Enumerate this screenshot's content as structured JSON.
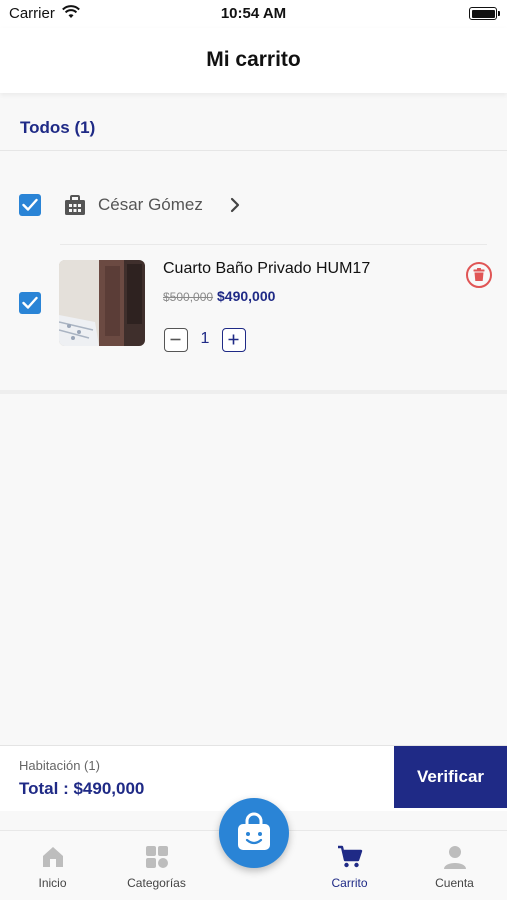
{
  "status_bar": {
    "carrier": "Carrier",
    "time": "10:54 AM"
  },
  "nav": {
    "title": "Mi carrito"
  },
  "cart": {
    "select_all_label": "Todos (1)",
    "seller": {
      "name": "César Gómez",
      "checked": true
    },
    "item": {
      "title": "Cuarto Baño Privado HUM17",
      "old_price": "$500,000",
      "price": "$490,000",
      "quantity": "1",
      "checked": true
    }
  },
  "summary": {
    "count_label": "Habitación (1)",
    "total_label": "Total : $490,000",
    "verify_label": "Verificar"
  },
  "tabs": [
    {
      "label": "Inicio",
      "icon": "home-icon"
    },
    {
      "label": "Categorías",
      "icon": "grid-icon"
    },
    {
      "label": "Carrito",
      "icon": "cart-icon",
      "active": true
    },
    {
      "label": "Cuenta",
      "icon": "user-icon"
    }
  ],
  "fab": {
    "icon": "shopping-bag-icon"
  },
  "colors": {
    "primary": "#1f2a86",
    "accent": "#2a84d6",
    "danger": "#e05555"
  }
}
